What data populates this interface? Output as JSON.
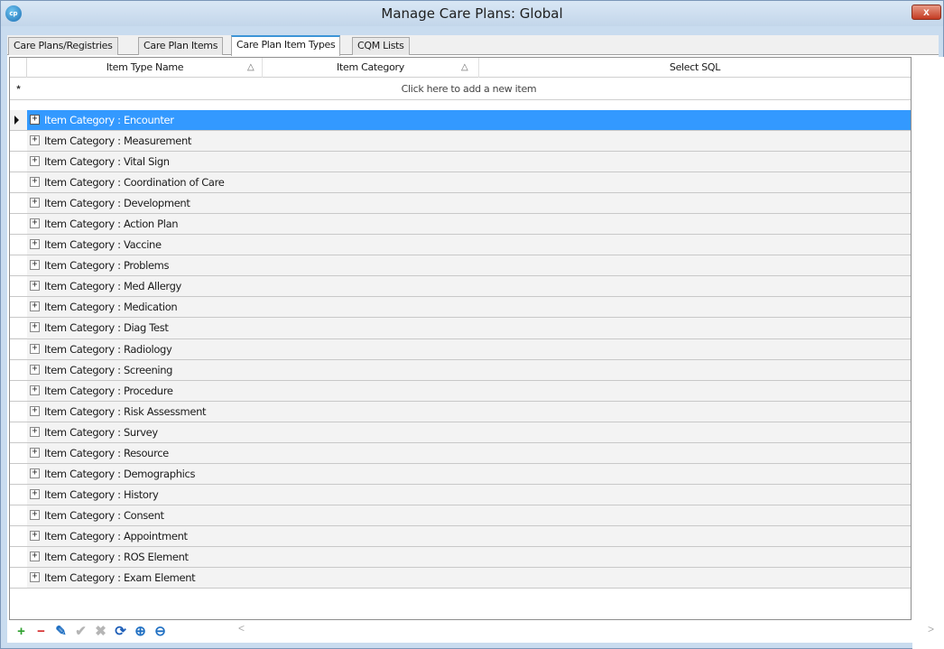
{
  "window": {
    "title": "Manage Care Plans: Global",
    "logo_text": "cp",
    "close_glyph": "x"
  },
  "tabs": [
    {
      "label": "Care Plans/Registries",
      "active": false
    },
    {
      "label": "Care Plan Items",
      "active": false
    },
    {
      "label": "Care Plan Item Types",
      "active": true
    },
    {
      "label": "CQM Lists",
      "active": false
    }
  ],
  "grid": {
    "columns": [
      {
        "label": "Item Type Name",
        "sortable": true
      },
      {
        "label": "Item Category",
        "sortable": true
      },
      {
        "label": "Select SQL",
        "sortable": false
      }
    ],
    "sort_glyph": "△",
    "new_row_marker": "*",
    "new_row_text": "Click here to add a new item",
    "groups": [
      {
        "label": "Item Category : Encounter",
        "selected": true
      },
      {
        "label": "Item Category : Measurement"
      },
      {
        "label": "Item Category : Vital Sign"
      },
      {
        "label": "Item Category : Coordination of Care"
      },
      {
        "label": "Item Category : Development"
      },
      {
        "label": "Item Category : Action Plan"
      },
      {
        "label": "Item Category : Vaccine"
      },
      {
        "label": "Item Category : Problems"
      },
      {
        "label": "Item Category : Med Allergy"
      },
      {
        "label": "Item Category : Medication"
      },
      {
        "label": "Item Category : Diag Test"
      },
      {
        "label": "Item Category : Radiology"
      },
      {
        "label": "Item Category : Screening"
      },
      {
        "label": "Item Category : Procedure"
      },
      {
        "label": "Item Category : Risk Assessment"
      },
      {
        "label": "Item Category : Survey"
      },
      {
        "label": "Item Category : Resource"
      },
      {
        "label": "Item Category : Demographics"
      },
      {
        "label": "Item Category : History"
      },
      {
        "label": "Item Category : Consent"
      },
      {
        "label": "Item Category : Appointment"
      },
      {
        "label": "Item Category : ROS Element"
      },
      {
        "label": "Item Category : Exam Element"
      }
    ]
  },
  "toolbar": [
    {
      "icon": "add-icon",
      "glyph": "+",
      "color": "#2ea02e"
    },
    {
      "icon": "remove-icon",
      "glyph": "−",
      "color": "#d42a2a"
    },
    {
      "icon": "edit-icon",
      "glyph": "✎",
      "color": "#1f6fc2"
    },
    {
      "icon": "accept-icon",
      "glyph": "✔",
      "color": "#b5b5b5"
    },
    {
      "icon": "cancel-icon",
      "glyph": "✖",
      "color": "#b5b5b5"
    },
    {
      "icon": "refresh-icon",
      "glyph": "⟳",
      "color": "#1f5fb8"
    },
    {
      "icon": "zoom-in-icon",
      "glyph": "⊕",
      "color": "#1f6fc2"
    },
    {
      "icon": "zoom-out-icon",
      "glyph": "⊖",
      "color": "#1f6fc2"
    }
  ],
  "scroll": {
    "left_glyph": "<",
    "right_glyph": ">"
  }
}
